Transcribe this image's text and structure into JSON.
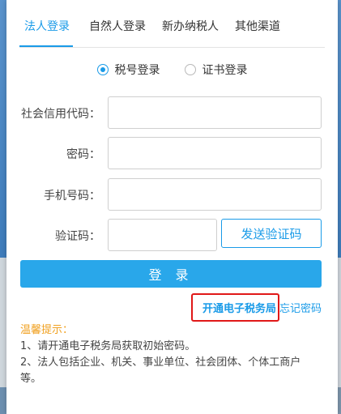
{
  "tabs": [
    "法人登录",
    "自然人登录",
    "新办纳税人",
    "其他渠道"
  ],
  "login_mode": {
    "options": [
      "税号登录",
      "证书登录"
    ],
    "selected": "税号登录"
  },
  "form": {
    "credit_code_label": "社会信用代码：",
    "password_label": "密码：",
    "phone_label": "手机号码：",
    "captcha_label": "验证码：",
    "send_code_button": "发送验证码"
  },
  "login_button": "登 录",
  "links": {
    "open_e_tax": "开通电子税务局",
    "forgot_password": "忘记密码"
  },
  "tips": {
    "title": "温馨提示：",
    "lines": [
      "1、请开通电子税务局获取初始密码。",
      "2、法人包括企业、机关、事业单位、社会团体、个体工商户",
      "等。"
    ]
  },
  "colors": {
    "accent": "#1a9be8",
    "button": "#29a7ea",
    "tip_title": "#f0a020",
    "highlight_border": "#e01818"
  }
}
